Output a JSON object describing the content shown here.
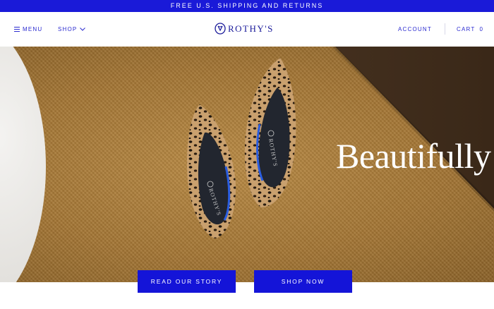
{
  "promo": {
    "text": "FREE U.S. SHIPPING AND RETURNS"
  },
  "nav": {
    "menu_label": "MENU",
    "shop_label": "SHOP",
    "logo_text": "ROTHY'S",
    "account_label": "ACCOUNT",
    "cart_label": "CART",
    "cart_count": "0"
  },
  "hero": {
    "headline": "Beautifully s",
    "shoe_brand_mark": "ROTHY'S"
  },
  "buttons": {
    "story_label": "READ OUR STORY",
    "shop_label": "SHOP NOW"
  },
  "colors": {
    "brand_blue": "#1414d8",
    "logo_blue": "#1a1a9a"
  }
}
